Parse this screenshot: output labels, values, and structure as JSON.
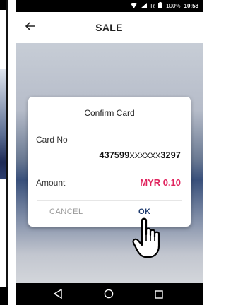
{
  "status_bar": {
    "battery": "100%",
    "time": "10:58",
    "network": "R"
  },
  "app_bar": {
    "title": "SALE",
    "back_icon": "back-arrow-icon"
  },
  "dialog": {
    "title": "Confirm Card",
    "card_label": "Card No",
    "card_prefix": "437599",
    "card_mask": "XXXXXX",
    "card_suffix": "3297",
    "amount_label": "Amount",
    "amount_value": "MYR 0.10",
    "cancel_label": "CANCEL",
    "ok_label": "OK"
  },
  "colors": {
    "amount": "#e0245e",
    "ok": "#1d3a6e",
    "cancel": "#9a9a9a"
  },
  "nav_bar": {
    "icons": [
      "nav-back-icon",
      "nav-home-icon",
      "nav-recent-icon"
    ]
  }
}
